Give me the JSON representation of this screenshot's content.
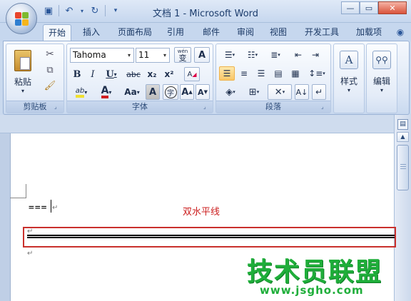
{
  "title_bar": {
    "title": "文档 1 - Microsoft Word"
  },
  "quick_access": {
    "icons": [
      "save-icon",
      "undo-icon",
      "redo-icon",
      "customize-icon"
    ]
  },
  "tabs": [
    {
      "label": "开始",
      "active": true
    },
    {
      "label": "插入"
    },
    {
      "label": "页面布局"
    },
    {
      "label": "引用"
    },
    {
      "label": "邮件"
    },
    {
      "label": "审阅"
    },
    {
      "label": "视图"
    },
    {
      "label": "开发工具"
    },
    {
      "label": "加载项"
    }
  ],
  "ribbon": {
    "clipboard": {
      "group_label": "剪贴板",
      "paste_label": "粘贴"
    },
    "font": {
      "group_label": "字体",
      "font_name": "Tahoma",
      "font_size": "11",
      "wen_label": "wén",
      "wen_char": "变",
      "bold": "B",
      "italic": "I",
      "underline": "U",
      "strike": "abc",
      "subscript": "x₂",
      "superscript": "x²",
      "grow": "A",
      "shrink": "A",
      "change_case": "Aa",
      "char_shade": "A",
      "enclose": "字",
      "clear": "A",
      "highlight": "ab",
      "font_color": "A"
    },
    "paragraph": {
      "group_label": "段落"
    },
    "styles": {
      "label": "样式"
    },
    "editing": {
      "label": "编辑"
    }
  },
  "document": {
    "equals_text": "===",
    "annotation": "双水平线",
    "paragraph_mark": "↵"
  },
  "watermark": {
    "brand": "技术员联盟",
    "url": "www.jsgho.com"
  },
  "colors": {
    "highlight": "#f0e030",
    "font_color": "#d02020",
    "annotation": "#cc2020",
    "watermark": "#1fae3a"
  }
}
